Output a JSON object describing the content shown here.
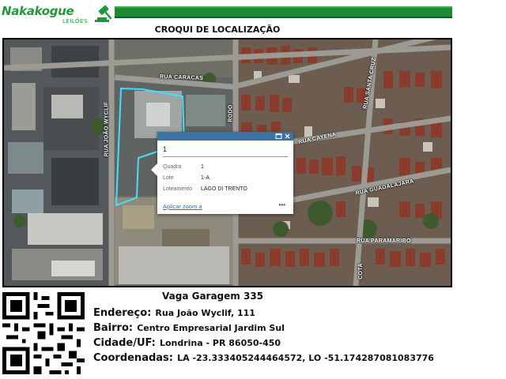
{
  "header": {
    "brand_name": "Nakakogue",
    "brand_sub": "LEILÕES",
    "title": "CROQUI DE LOCALIZAÇÃO"
  },
  "colors": {
    "brand_green": "#1f9a3a",
    "bar_green": "#1d8a35",
    "parcel_outline": "#3fe0ff",
    "popup_header": "#3a73a8"
  },
  "map": {
    "streets": {
      "caracas": "RUA CARACAS",
      "joao_wyclif": "RUA JOÃO WYCLIF",
      "caiena": "RUA CAYENA",
      "guadalajara": "RUA GUADALAJARA",
      "paramaribo": "RUA PARAMARIBO",
      "santa_cruz": "RUA SANTA CRUZ",
      "rodo": "RODO",
      "cota": "COTA"
    },
    "popup": {
      "title": "1",
      "rows": [
        {
          "key": "Quadra",
          "value": "1"
        },
        {
          "key": "Lote",
          "value": "1-A"
        },
        {
          "key": "Loteamento",
          "value": "LAGO DI TRENTO"
        }
      ],
      "zoom_link": "Aplicar zoom a",
      "more": "•••",
      "icons": [
        "minimize-icon",
        "close-icon"
      ]
    }
  },
  "footer": {
    "vaga": "Vaga Garagem 335",
    "endereco_label": "Endereço:",
    "endereco_value": "Rua João Wyclif, 111",
    "bairro_label": "Bairro:",
    "bairro_value": "Centro Empresarial Jardim Sul",
    "cidade_label": "Cidade/UF:",
    "cidade_value": "Londrina - PR 86050-450",
    "coord_label": "Coordenadas:",
    "coord_value": "LA -23.333405244464572, LO -51.174287081083776"
  }
}
